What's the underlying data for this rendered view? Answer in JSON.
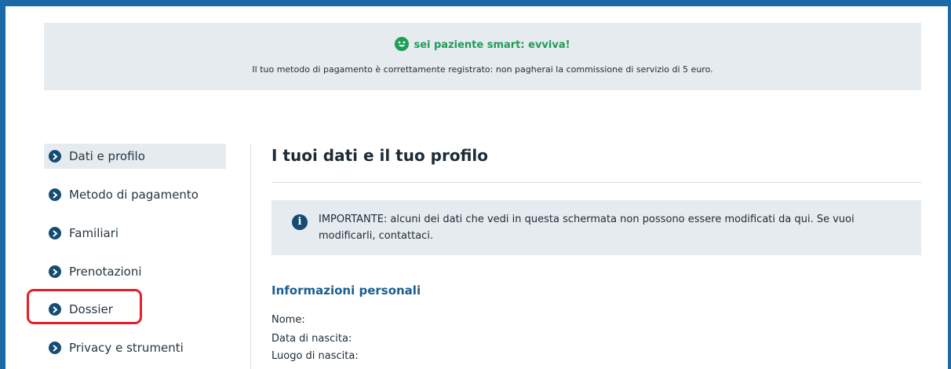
{
  "colors": {
    "frame": "#1a6aa8",
    "banner_bg": "#e6ebef",
    "success": "#1f9d55",
    "nav_icon": "#154c74",
    "section_title": "#1a5e92",
    "highlight": "#e0202a"
  },
  "banner": {
    "icon": "smiley-icon",
    "title": "sei paziente smart: evviva!",
    "text": "Il tuo metodo di pagamento è correttamente registrato: non pagherai la commissione di servizio di 5 euro."
  },
  "sidebar": {
    "items": [
      {
        "label": "Dati e profilo",
        "icon": "chevron-right-icon",
        "active": true
      },
      {
        "label": "Metodo di pagamento",
        "icon": "chevron-right-icon",
        "active": false
      },
      {
        "label": "Familiari",
        "icon": "chevron-right-icon",
        "active": false
      },
      {
        "label": "Prenotazioni",
        "icon": "chevron-right-icon",
        "active": false
      },
      {
        "label": "Dossier",
        "icon": "chevron-right-icon",
        "active": false,
        "highlighted": true
      },
      {
        "label": "Privacy e strumenti",
        "icon": "chevron-right-icon",
        "active": false
      }
    ]
  },
  "main": {
    "title": "I tuoi dati e il tuo profilo",
    "notice": {
      "icon": "info-icon",
      "text": "IMPORTANTE: alcuni dei dati che vedi in questa schermata non possono essere modificati da qui. Se vuoi modificarli, contattaci."
    },
    "section_title": "Informazioni personali",
    "fields": [
      {
        "label": "Nome:"
      },
      {
        "label": "Data di nascita:"
      },
      {
        "label": "Luogo di nascita:"
      }
    ]
  }
}
